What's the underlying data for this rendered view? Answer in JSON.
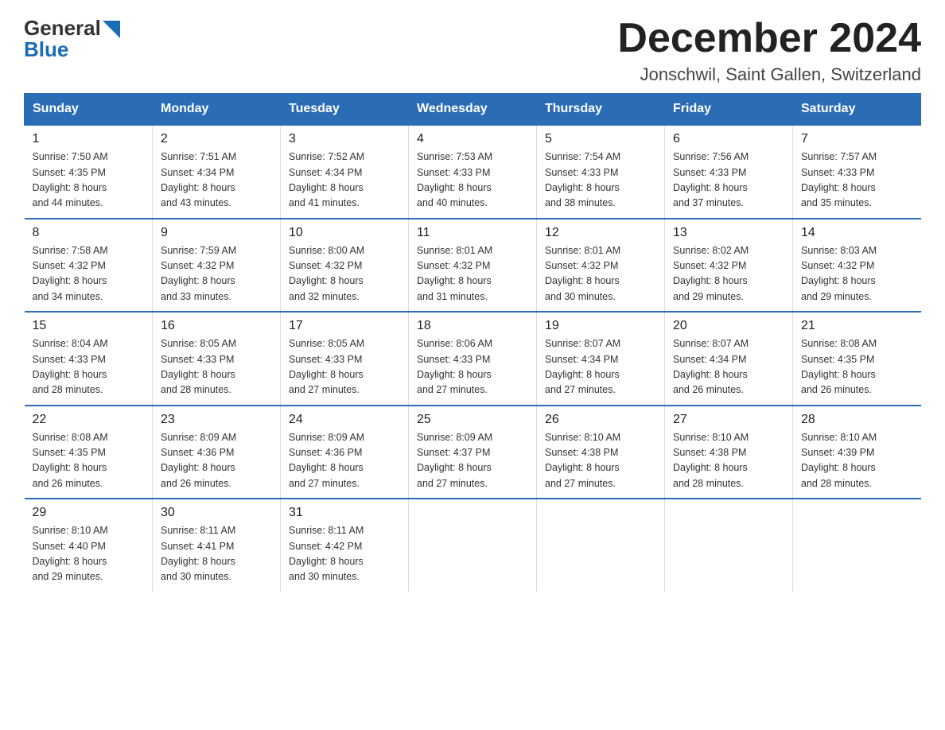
{
  "header": {
    "title": "December 2024",
    "location": "Jonschwil, Saint Gallen, Switzerland",
    "logo_general": "General",
    "logo_blue": "Blue"
  },
  "weekdays": [
    "Sunday",
    "Monday",
    "Tuesday",
    "Wednesday",
    "Thursday",
    "Friday",
    "Saturday"
  ],
  "weeks": [
    [
      {
        "day": "1",
        "sunrise": "7:50 AM",
        "sunset": "4:35 PM",
        "daylight": "8 hours and 44 minutes."
      },
      {
        "day": "2",
        "sunrise": "7:51 AM",
        "sunset": "4:34 PM",
        "daylight": "8 hours and 43 minutes."
      },
      {
        "day": "3",
        "sunrise": "7:52 AM",
        "sunset": "4:34 PM",
        "daylight": "8 hours and 41 minutes."
      },
      {
        "day": "4",
        "sunrise": "7:53 AM",
        "sunset": "4:33 PM",
        "daylight": "8 hours and 40 minutes."
      },
      {
        "day": "5",
        "sunrise": "7:54 AM",
        "sunset": "4:33 PM",
        "daylight": "8 hours and 38 minutes."
      },
      {
        "day": "6",
        "sunrise": "7:56 AM",
        "sunset": "4:33 PM",
        "daylight": "8 hours and 37 minutes."
      },
      {
        "day": "7",
        "sunrise": "7:57 AM",
        "sunset": "4:33 PM",
        "daylight": "8 hours and 35 minutes."
      }
    ],
    [
      {
        "day": "8",
        "sunrise": "7:58 AM",
        "sunset": "4:32 PM",
        "daylight": "8 hours and 34 minutes."
      },
      {
        "day": "9",
        "sunrise": "7:59 AM",
        "sunset": "4:32 PM",
        "daylight": "8 hours and 33 minutes."
      },
      {
        "day": "10",
        "sunrise": "8:00 AM",
        "sunset": "4:32 PM",
        "daylight": "8 hours and 32 minutes."
      },
      {
        "day": "11",
        "sunrise": "8:01 AM",
        "sunset": "4:32 PM",
        "daylight": "8 hours and 31 minutes."
      },
      {
        "day": "12",
        "sunrise": "8:01 AM",
        "sunset": "4:32 PM",
        "daylight": "8 hours and 30 minutes."
      },
      {
        "day": "13",
        "sunrise": "8:02 AM",
        "sunset": "4:32 PM",
        "daylight": "8 hours and 29 minutes."
      },
      {
        "day": "14",
        "sunrise": "8:03 AM",
        "sunset": "4:32 PM",
        "daylight": "8 hours and 29 minutes."
      }
    ],
    [
      {
        "day": "15",
        "sunrise": "8:04 AM",
        "sunset": "4:33 PM",
        "daylight": "8 hours and 28 minutes."
      },
      {
        "day": "16",
        "sunrise": "8:05 AM",
        "sunset": "4:33 PM",
        "daylight": "8 hours and 28 minutes."
      },
      {
        "day": "17",
        "sunrise": "8:05 AM",
        "sunset": "4:33 PM",
        "daylight": "8 hours and 27 minutes."
      },
      {
        "day": "18",
        "sunrise": "8:06 AM",
        "sunset": "4:33 PM",
        "daylight": "8 hours and 27 minutes."
      },
      {
        "day": "19",
        "sunrise": "8:07 AM",
        "sunset": "4:34 PM",
        "daylight": "8 hours and 27 minutes."
      },
      {
        "day": "20",
        "sunrise": "8:07 AM",
        "sunset": "4:34 PM",
        "daylight": "8 hours and 26 minutes."
      },
      {
        "day": "21",
        "sunrise": "8:08 AM",
        "sunset": "4:35 PM",
        "daylight": "8 hours and 26 minutes."
      }
    ],
    [
      {
        "day": "22",
        "sunrise": "8:08 AM",
        "sunset": "4:35 PM",
        "daylight": "8 hours and 26 minutes."
      },
      {
        "day": "23",
        "sunrise": "8:09 AM",
        "sunset": "4:36 PM",
        "daylight": "8 hours and 26 minutes."
      },
      {
        "day": "24",
        "sunrise": "8:09 AM",
        "sunset": "4:36 PM",
        "daylight": "8 hours and 27 minutes."
      },
      {
        "day": "25",
        "sunrise": "8:09 AM",
        "sunset": "4:37 PM",
        "daylight": "8 hours and 27 minutes."
      },
      {
        "day": "26",
        "sunrise": "8:10 AM",
        "sunset": "4:38 PM",
        "daylight": "8 hours and 27 minutes."
      },
      {
        "day": "27",
        "sunrise": "8:10 AM",
        "sunset": "4:38 PM",
        "daylight": "8 hours and 28 minutes."
      },
      {
        "day": "28",
        "sunrise": "8:10 AM",
        "sunset": "4:39 PM",
        "daylight": "8 hours and 28 minutes."
      }
    ],
    [
      {
        "day": "29",
        "sunrise": "8:10 AM",
        "sunset": "4:40 PM",
        "daylight": "8 hours and 29 minutes."
      },
      {
        "day": "30",
        "sunrise": "8:11 AM",
        "sunset": "4:41 PM",
        "daylight": "8 hours and 30 minutes."
      },
      {
        "day": "31",
        "sunrise": "8:11 AM",
        "sunset": "4:42 PM",
        "daylight": "8 hours and 30 minutes."
      },
      null,
      null,
      null,
      null
    ]
  ],
  "labels": {
    "sunrise": "Sunrise:",
    "sunset": "Sunset:",
    "daylight": "Daylight:"
  }
}
